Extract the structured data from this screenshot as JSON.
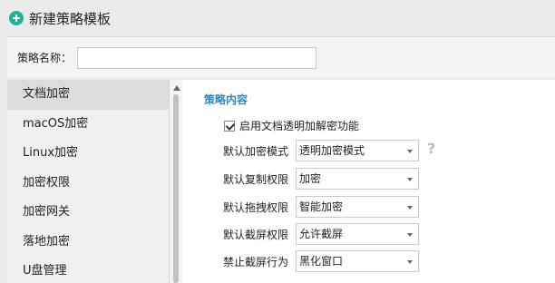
{
  "window": {
    "title": "新建策略模板"
  },
  "policy_name": {
    "label": "策略名称：",
    "value": "",
    "placeholder": ""
  },
  "nav": {
    "items": [
      {
        "label": "文档加密",
        "active": true
      },
      {
        "label": "macOS加密",
        "active": false
      },
      {
        "label": "Linux加密",
        "active": false
      },
      {
        "label": "加密权限",
        "active": false
      },
      {
        "label": "加密网关",
        "active": false
      },
      {
        "label": "落地加密",
        "active": false
      },
      {
        "label": "U盘管理",
        "active": false
      }
    ]
  },
  "content": {
    "section_title": "策略内容",
    "transparent_encrypt": {
      "label": "启用文档透明加解密功能",
      "checked": true
    },
    "fields": [
      {
        "label": "默认加密模式",
        "value": "透明加密模式"
      },
      {
        "label": "默认复制权限",
        "value": "加密"
      },
      {
        "label": "默认拖拽权限",
        "value": "智能加密"
      },
      {
        "label": "默认截屏权限",
        "value": "允许截屏"
      },
      {
        "label": "禁止截屏行为",
        "value": "黑化窗口"
      }
    ],
    "help_icon": "question-mark-icon"
  },
  "colors": {
    "accent": "#2a86c9",
    "app_icon": "#1fb39a",
    "nav_active": "#dcdcdc"
  }
}
